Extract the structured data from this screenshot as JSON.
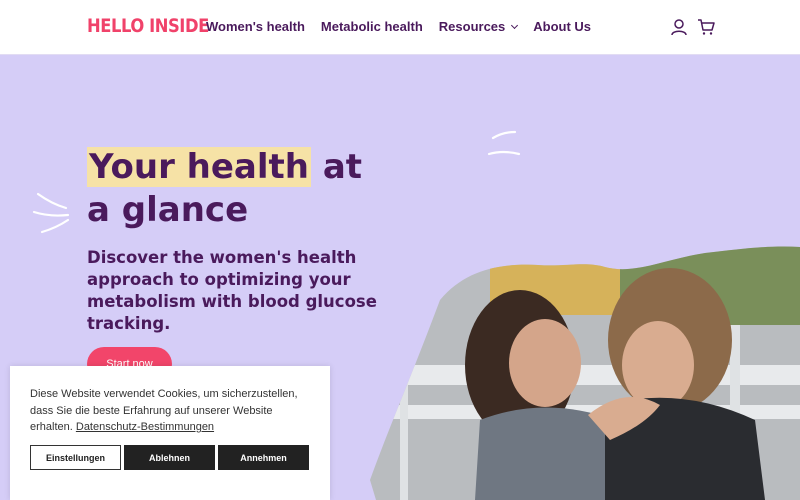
{
  "header": {
    "logo": "HELLO INSIDE",
    "nav": [
      {
        "label": "Women's health"
      },
      {
        "label": "Metabolic health"
      },
      {
        "label": "Resources"
      },
      {
        "label": "About Us"
      }
    ],
    "icons": [
      "account-icon",
      "cart-icon"
    ]
  },
  "hero": {
    "title_highlight": "Your health",
    "title_rest": " at a glance",
    "subtitle": "Discover the women's health approach to optimizing your metabolism with blood glucose tracking.",
    "cta": "Start now"
  },
  "cookie": {
    "text": "Diese Website verwendet Cookies, um sicherzustellen, dass Sie die beste Erfahrung auf unserer Website erhalten.",
    "link": "Datenschutz-Bestimmungen",
    "buttons": {
      "settings": "Einstellungen",
      "decline": "Ablehnen",
      "accept": "Annehmen"
    }
  },
  "colors": {
    "background": "#d5cdf7",
    "brand": "#f0426a",
    "text": "#4a1a5c",
    "highlight": "#f6e2a6",
    "button_dark": "#222222"
  }
}
